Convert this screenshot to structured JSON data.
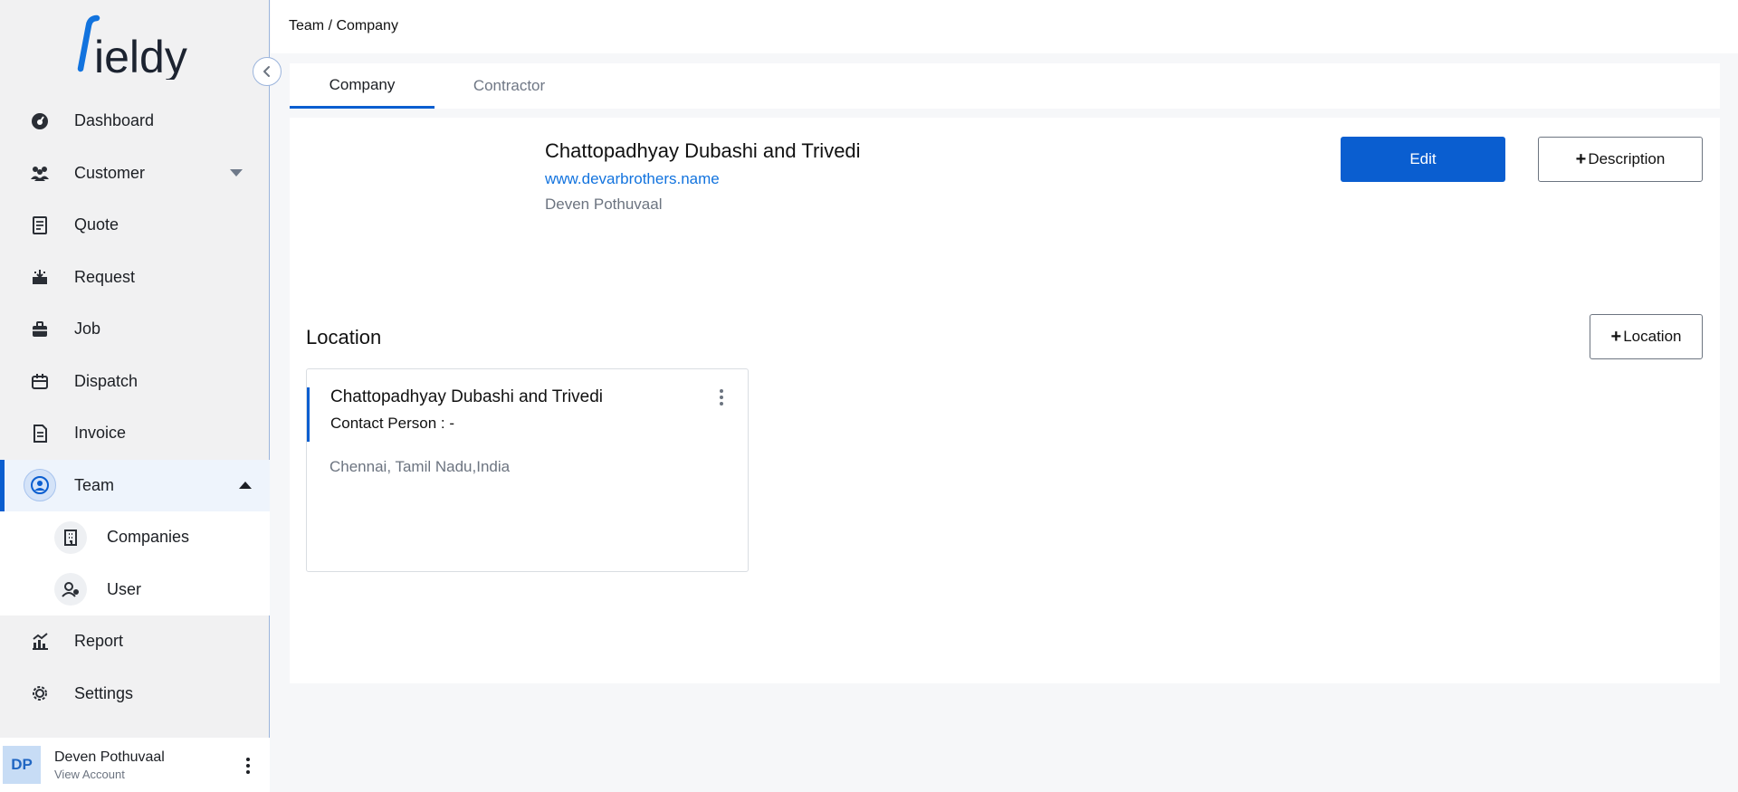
{
  "app": {
    "logo_text": "fieldy",
    "brand_color": "#0a5ed0"
  },
  "sidebar": {
    "items": [
      {
        "label": "Dashboard",
        "icon": "dashboard-icon"
      },
      {
        "label": "Customer",
        "icon": "customers-icon",
        "expandable": true
      },
      {
        "label": "Quote",
        "icon": "quote-icon"
      },
      {
        "label": "Request",
        "icon": "request-icon"
      },
      {
        "label": "Job",
        "icon": "job-icon"
      },
      {
        "label": "Dispatch",
        "icon": "dispatch-icon"
      },
      {
        "label": "Invoice",
        "icon": "invoice-icon"
      },
      {
        "label": "Team",
        "icon": "team-icon",
        "active": true,
        "expanded": true
      },
      {
        "label": "Report",
        "icon": "report-icon"
      },
      {
        "label": "Settings",
        "icon": "settings-icon"
      }
    ],
    "team_subitems": [
      {
        "label": "Companies",
        "icon": "building-icon"
      },
      {
        "label": "User",
        "icon": "user-icon"
      }
    ],
    "user": {
      "initials": "DP",
      "name": "Deven Pothuvaal",
      "sub": "View Account"
    }
  },
  "header": {
    "breadcrumb": "Team / Company"
  },
  "tabs": [
    {
      "label": "Company",
      "active": true
    },
    {
      "label": "Contractor",
      "active": false
    }
  ],
  "company": {
    "name": "Chattopadhyay Dubashi and Trivedi",
    "website": "www.devarbrothers.name",
    "owner": "Deven Pothuvaal",
    "edit_label": "Edit",
    "description_label": "Description"
  },
  "location": {
    "heading": "Location",
    "add_label": "Location",
    "cards": [
      {
        "title": "Chattopadhyay Dubashi and Trivedi",
        "contact": "Contact Person : -",
        "address": "Chennai, Tamil Nadu,India"
      }
    ]
  }
}
